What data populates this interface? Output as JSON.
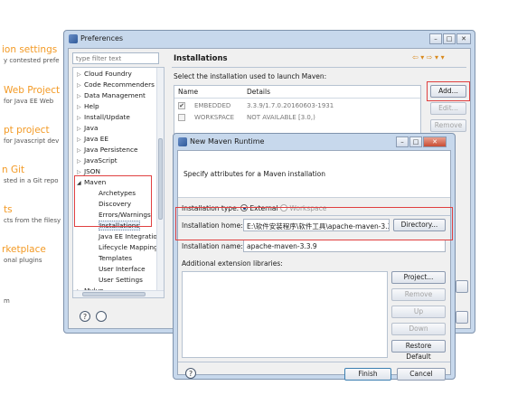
{
  "background": {
    "items": [
      {
        "title": "ion settings",
        "desc": "y contested prefe"
      },
      {
        "title": "Web Project",
        "desc": "for Java EE Web"
      },
      {
        "title": "pt project",
        "desc": "for Javascript dev"
      },
      {
        "title": "n Git",
        "desc": "sted in a Git repo"
      },
      {
        "title": "ts",
        "desc": "cts from the filesy"
      },
      {
        "title": "rketplace",
        "desc": "onal plugins"
      }
    ],
    "fragment": "m"
  },
  "preferences": {
    "title": "Preferences",
    "filter_placeholder": "type filter text",
    "tree": [
      {
        "label": "Cloud Foundry",
        "arrow": "▷"
      },
      {
        "label": "Code Recommenders",
        "arrow": "▷"
      },
      {
        "label": "Data Management",
        "arrow": "▷"
      },
      {
        "label": "Help",
        "arrow": "▷"
      },
      {
        "label": "Install/Update",
        "arrow": "▷"
      },
      {
        "label": "Java",
        "arrow": "▷"
      },
      {
        "label": "Java EE",
        "arrow": "▷"
      },
      {
        "label": "Java Persistence",
        "arrow": "▷"
      },
      {
        "label": "JavaScript",
        "arrow": "▷"
      },
      {
        "label": "JSON",
        "arrow": "▷"
      },
      {
        "label": "Maven",
        "arrow": "◢"
      },
      {
        "label": "Archetypes",
        "arrow": ""
      },
      {
        "label": "Discovery",
        "arrow": ""
      },
      {
        "label": "Errors/Warnings",
        "arrow": ""
      },
      {
        "label": "Installations",
        "arrow": ""
      },
      {
        "label": "Java EE Integratio",
        "arrow": ""
      },
      {
        "label": "Lifecycle Mapping",
        "arrow": ""
      },
      {
        "label": "Templates",
        "arrow": ""
      },
      {
        "label": "User Interface",
        "arrow": ""
      },
      {
        "label": "User Settings",
        "arrow": ""
      },
      {
        "label": "Mylyn",
        "arrow": "▷"
      }
    ],
    "panel_title": "Installations",
    "description": "Select the installation used to launch Maven:",
    "columns": {
      "name": "Name",
      "details": "Details"
    },
    "rows": [
      {
        "checked": "✔",
        "name": "EMBEDDED",
        "details": "3.3.9/1.7.0.20160603-1931"
      },
      {
        "checked": "",
        "name": "WORKSPACE",
        "details": "NOT AVAILABLE [3.0,)"
      }
    ],
    "buttons": {
      "add": "Add...",
      "edit": "Edit...",
      "remove": "Remove"
    },
    "help_glyph": "?"
  },
  "dialog": {
    "title": "New Maven Runtime",
    "banner_text": "Specify attributes for a Maven installation",
    "type_label": "Installation type:",
    "type_external": "External",
    "type_workspace": "Workspace",
    "home_label": "Installation home:",
    "home_value": "E:\\软件安装程序\\软件工具\\apache-maven-3.3.9",
    "directory_button": "Directory...",
    "name_label": "Installation name:",
    "name_value": "apache-maven-3.3.9",
    "libs_label": "Additional extension libraries:",
    "buttons": {
      "project": "Project...",
      "remove": "Remove",
      "up": "Up",
      "down": "Down",
      "restore": "Restore Default",
      "finish": "Finish",
      "cancel": "Cancel"
    },
    "help_glyph": "?"
  },
  "colors": {
    "accent_red": "#e04040",
    "welcome_orange": "#f39a25"
  }
}
